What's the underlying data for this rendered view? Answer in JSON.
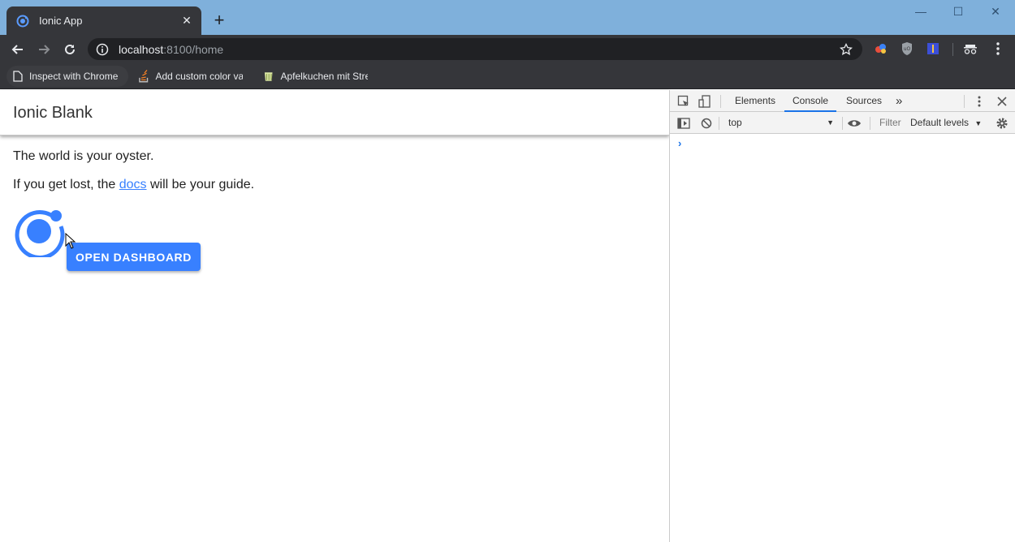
{
  "browser": {
    "tab_title": "Ionic App",
    "tab_close": "✕",
    "new_tab": "+",
    "url_host": "localhost",
    "url_path": ":8100/home",
    "window_controls": {
      "minimize": "—",
      "maximize": "☐",
      "close": "✕"
    }
  },
  "bookmarks": [
    {
      "label": "Inspect with Chrome",
      "icon": "page-icon"
    },
    {
      "label": "Add custom color var",
      "icon": "stackoverflow-icon"
    },
    {
      "label": "Apfelkuchen mit Stre",
      "icon": "recipe-icon"
    }
  ],
  "app": {
    "title": "Ionic Blank",
    "line1": "The world is your oyster.",
    "line2_prefix": "If you get lost, the ",
    "line2_link": "docs",
    "line2_suffix": " will be your guide.",
    "button_label": "OPEN DASHBOARD",
    "accent": "#3880ff"
  },
  "devtools": {
    "tabs": [
      "Elements",
      "Console",
      "Sources"
    ],
    "active_tab": "Console",
    "more": "»",
    "context": "top",
    "filter_placeholder": "Filter",
    "levels": "Default levels",
    "prompt": "›"
  }
}
